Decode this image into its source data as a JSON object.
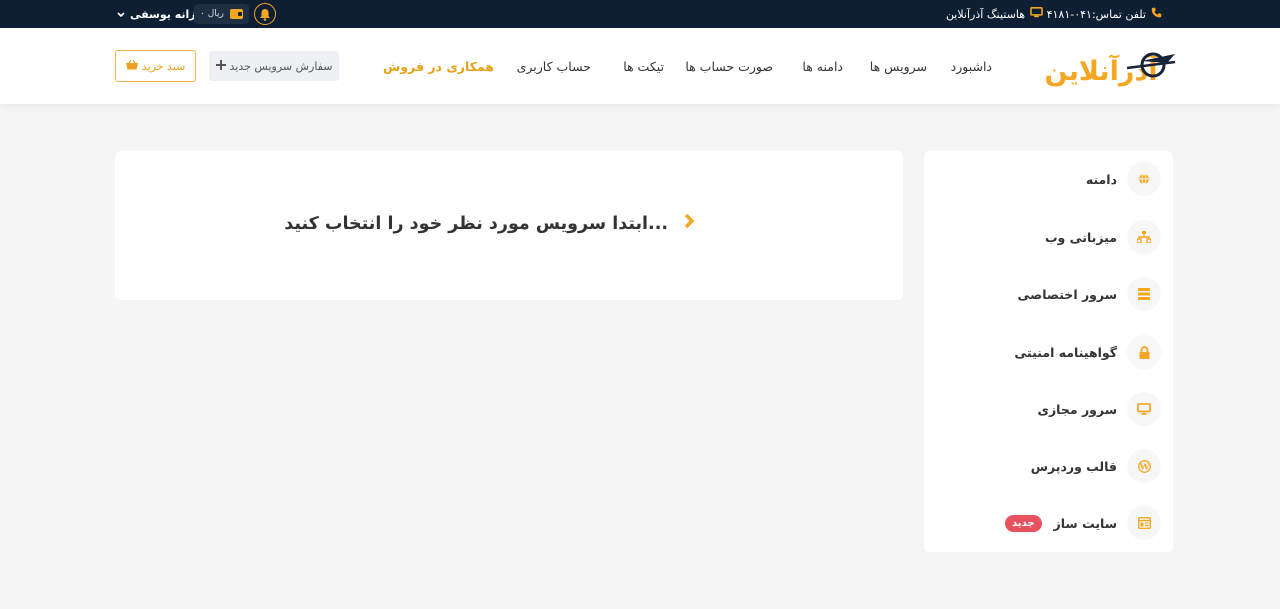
{
  "topbar": {
    "phone_label": "تلفن تماس:۰۴۱-۴۱۸۱",
    "hosting_label": "هاستینگ آذرآنلاین",
    "user_name": "فرزانه یوسفی",
    "wallet_text": "۰ ریال"
  },
  "logo": {
    "text": "آذرآنلاین"
  },
  "nav": {
    "dashboard": "داشبورد",
    "services": "سرویس ها",
    "domains": "دامنه ها",
    "invoices": "صورت حساب ها",
    "tickets": "تیکت ها",
    "account": "حساب کاربری",
    "affiliate": "همکاری در فروش"
  },
  "actions": {
    "order_new": "سفارش سرویس جدید",
    "cart": "سبد خرید"
  },
  "main": {
    "message": "ابتدا سرویس مورد نظر خود را انتخاب کنید..."
  },
  "sidebar": {
    "items": [
      {
        "label": "دامنه",
        "icon": "globe-icon"
      },
      {
        "label": "میزبانی وب",
        "icon": "sitemap-icon"
      },
      {
        "label": "سرور اختصاصی",
        "icon": "server-icon"
      },
      {
        "label": "گواهینامه امنیتی",
        "icon": "lock-icon"
      },
      {
        "label": "سرور مجازی",
        "icon": "monitor-icon"
      },
      {
        "label": "قالب وردپرس",
        "icon": "wordpress-icon"
      },
      {
        "label": "سایت ساز",
        "icon": "site-builder-icon",
        "badge": "جدید"
      }
    ]
  },
  "colors": {
    "accent": "#f5a623",
    "dark": "#0e1f33",
    "badge": "#e8525f"
  }
}
